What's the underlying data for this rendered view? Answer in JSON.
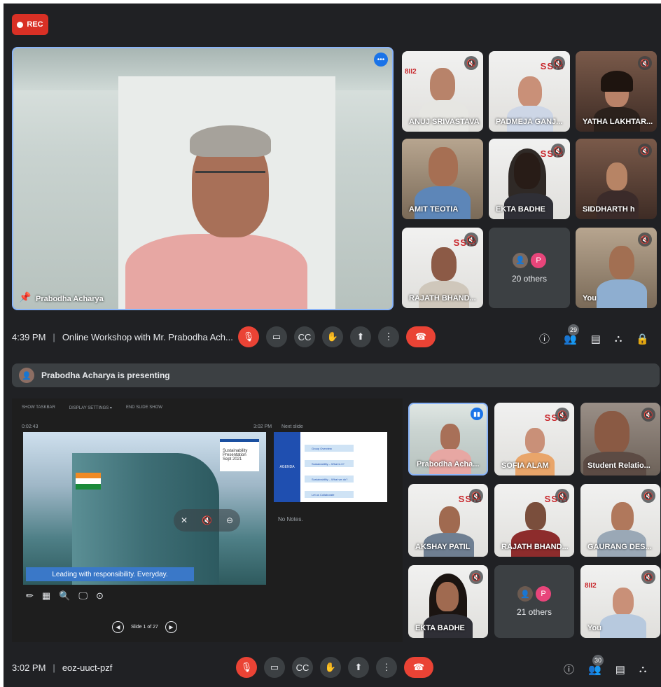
{
  "recording": {
    "label": "REC"
  },
  "meeting1": {
    "time": "4:39 PM",
    "title": "Online Workshop with Mr. Prabodha Ach...",
    "participant_count": "29",
    "main_speaker": "Prabodha Acharya",
    "tiles": [
      {
        "name": "ANUJ SRIVASTAVA"
      },
      {
        "name": "PADMEJA GANJ..."
      },
      {
        "name": "YATHA LAKHTAR..."
      },
      {
        "name": "AMIT TEOTIA"
      },
      {
        "name": "EKTA BADHE"
      },
      {
        "name": "SIDDHARTH h"
      },
      {
        "name": "RAJATH BHAND..."
      },
      {
        "name": "20 others",
        "avatar_letter": "P"
      },
      {
        "name": "You"
      }
    ]
  },
  "presenting_banner": {
    "text": "Prabodha Acharya is presenting"
  },
  "presentation": {
    "toolbar": [
      "SHOW TASKBAR",
      "DISPLAY SETTINGS ▾",
      "END SLIDE SHOW"
    ],
    "timer": "0:02:43",
    "clock": "3:02 PM",
    "next_slide_label": "Next slide",
    "slide_card": {
      "line1": "Sustainability",
      "line2": "Presentation",
      "line3": "Sept 2021"
    },
    "tagline": "Leading with  responsibility.  Everyday.",
    "agenda_label": "AGENDA",
    "agenda_items": [
      "Group Overview",
      "Sustainability – What is it?",
      "Sustainability – What we do?",
      "Let us Collaborate"
    ],
    "notes": "No Notes.",
    "slide_counter": "Slide 1 of 27"
  },
  "meeting2": {
    "time": "3:02 PM",
    "code": "eoz-uuct-pzf",
    "participant_count": "30",
    "tiles": [
      {
        "name": "Prabodha Acha..."
      },
      {
        "name": "SOFIA ALAM"
      },
      {
        "name": "Student Relatio..."
      },
      {
        "name": "AKSHAY PATIL"
      },
      {
        "name": "RAJATH BHAND..."
      },
      {
        "name": "GAURANG DES..."
      },
      {
        "name": "EKTA BADHE"
      },
      {
        "name": "21 others",
        "avatar_letter": "P"
      },
      {
        "name": "You"
      }
    ]
  },
  "colors": {
    "background": "#202124",
    "tile": "#3c4043",
    "danger": "#ea4335",
    "accent": "#8ab4f8"
  }
}
